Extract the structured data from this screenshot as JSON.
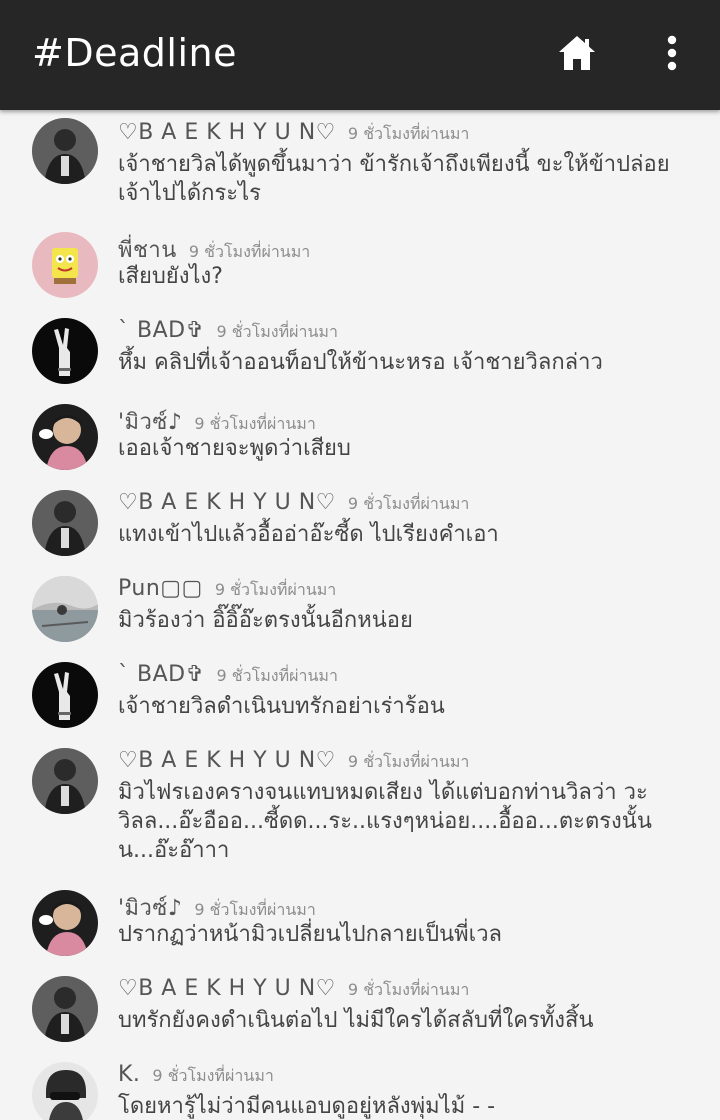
{
  "app_bar": {
    "title": "#Deadline",
    "home_icon": "home-icon",
    "menu_icon": "more-vert-icon"
  },
  "colors": {
    "app_bar_bg": "#262626",
    "background": "#f4f4f4",
    "username": "#555555",
    "timestamp": "#8c8c8c",
    "text": "#444444"
  },
  "comments": [
    {
      "user": "♡B A E K H Y U N♡",
      "time": "9 ชั่วโมงที่ผ่านมา",
      "text": "เจ้าชายวิลได้พูดขึ้นมาว่า ข้ารักเจ้าถึงเพียงนี้ ขะให้ข้าปล่อยเจ้าไปได้กระไร",
      "avatar": "baekhyun-avatar"
    },
    {
      "user": "พี่ชาน",
      "time": "9 ชั่วโมงที่ผ่านมา",
      "text": "เสียบยังไง?",
      "avatar": "sponge-avatar"
    },
    {
      "user": "` BAD✞",
      "time": "9 ชั่วโมงที่ผ่านมา",
      "text": "หึ้ม คลิปที่เจ้าออนท็อปให้ข้านะหรอ เจ้าชายวิลกล่าว",
      "avatar": "hand-avatar"
    },
    {
      "user": "'มิวซ์♪",
      "time": "9 ชั่วโมงที่ผ่านมา",
      "text": "เออเจ้าชายจะพูดว่าเสียบ",
      "avatar": "mew-avatar"
    },
    {
      "user": "♡B A E K H Y U N♡",
      "time": "9 ชั่วโมงที่ผ่านมา",
      "text": "แทงเข้าไปแล้วอื้ออ่าอ๊ะซี้ด ไปเรียงคำเอา",
      "avatar": "baekhyun-avatar"
    },
    {
      "user": "Pun▢▢",
      "time": "9 ชั่วโมงที่ผ่านมา",
      "text": "มิวร้องว่า อิ๊อิ๊อ๊ะตรงนั้นอีกหน่อย",
      "avatar": "pun-avatar"
    },
    {
      "user": "` BAD✞",
      "time": "9 ชั่วโมงที่ผ่านมา",
      "text": "เจ้าชายวิลดำเนินบทรักอย่าเร่าร้อน",
      "avatar": "hand-avatar"
    },
    {
      "user": "♡B A E K H Y U N♡",
      "time": "9 ชั่วโมงที่ผ่านมา",
      "text": "มิวไฟรเองครางจนแทบหมดเสียง ได้แต่บอกท่านวิลว่า วะวิลล...อ๊ะอืออ...ซี้ดด...ระ..แรงๆหน่อย....อื้ออ...ตะตรงนั้น น...อ๊ะอ๊าาา",
      "avatar": "baekhyun-avatar"
    },
    {
      "user": "'มิวซ์♪",
      "time": "9 ชั่วโมงที่ผ่านมา",
      "text": "ปรากฏว่าหน้ามิวเปลี่ยนไปกลายเป็นพี่เวล",
      "avatar": "mew-avatar"
    },
    {
      "user": "♡B A E K H Y U N♡",
      "time": "9 ชั่วโมงที่ผ่านมา",
      "text": "บทรักยังคงดำเนินต่อไป ไม่มีใครได้สลับที่ใครทั้งสิ้น",
      "avatar": "baekhyun-avatar"
    },
    {
      "user": "K.",
      "time": "9 ชั่วโมงที่ผ่านมา",
      "text": "โดยหารู้ไม่ว่ามีคนแอบดูอยู่หลังพุ่มไม้ - -",
      "avatar": "k-avatar"
    }
  ]
}
